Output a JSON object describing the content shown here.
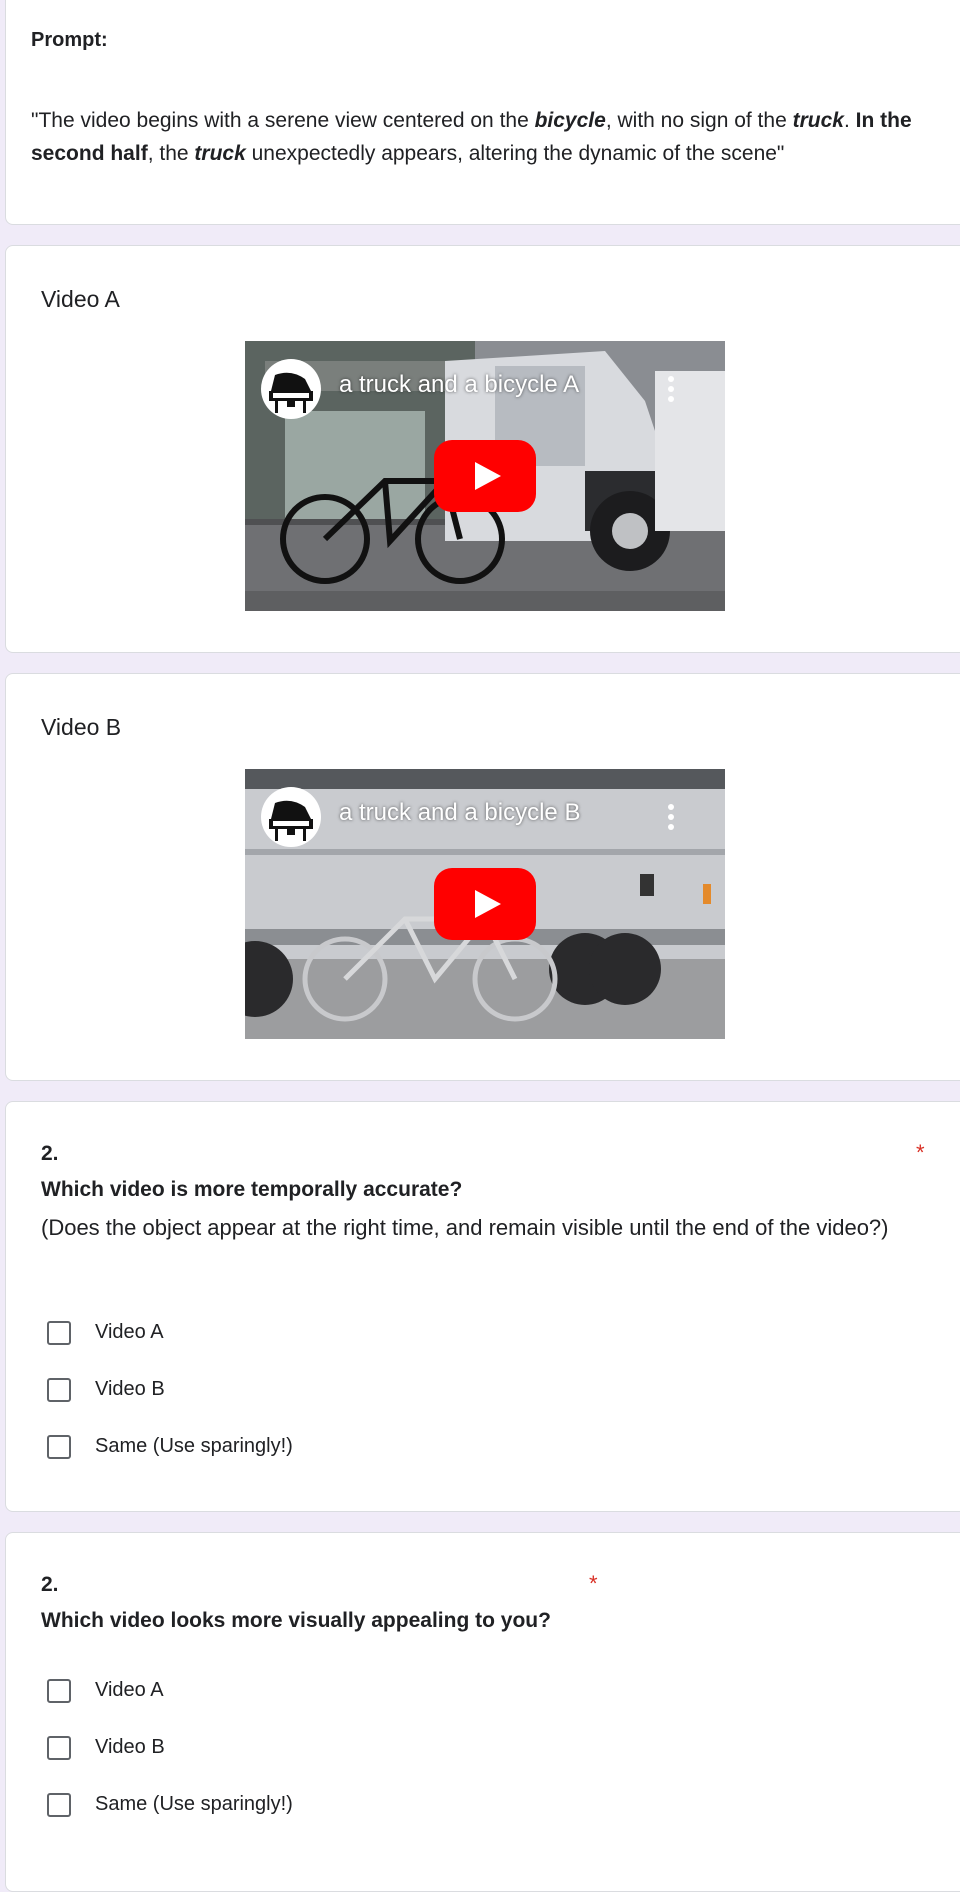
{
  "prompt": {
    "label": "Prompt:",
    "parts": [
      {
        "text": "\"The video begins with a serene view centered on the ",
        "style": "normal"
      },
      {
        "text": "bicycle",
        "style": "bold-italic"
      },
      {
        "text": ", with no sign of the ",
        "style": "normal"
      },
      {
        "text": "truck",
        "style": "bold-italic"
      },
      {
        "text": ". ",
        "style": "normal"
      },
      {
        "text": "In the second half",
        "style": "bold"
      },
      {
        "text": ", the ",
        "style": "normal"
      },
      {
        "text": "truck",
        "style": "bold-italic"
      },
      {
        "text": " unexpectedly appears, altering the dynamic of the scene\"",
        "style": "normal"
      }
    ]
  },
  "videos": [
    {
      "section_title": "Video A",
      "player_title": "a truck and a bicycle A"
    },
    {
      "section_title": "Video B",
      "player_title": "a truck and a bicycle B"
    }
  ],
  "questions": [
    {
      "number": "2.",
      "required_mark": "*",
      "title": "Which video is more temporally accurate?",
      "description": "(Does the object appear at the right time, and remain visible until the end of the video?)",
      "options": [
        "Video A",
        "Video B",
        "Same (Use sparingly!)"
      ]
    },
    {
      "number": "2.",
      "required_mark": "*",
      "title": "Which video looks more visually appealing to you?",
      "options": [
        "Video A",
        "Video B",
        "Same (Use sparingly!)"
      ]
    }
  ],
  "colors": {
    "page_background": "#f0ebf8",
    "required": "#d93025",
    "play_button": "#ff0000"
  },
  "icons": [
    "piano-icon",
    "more-vert-icon",
    "play-icon"
  ]
}
